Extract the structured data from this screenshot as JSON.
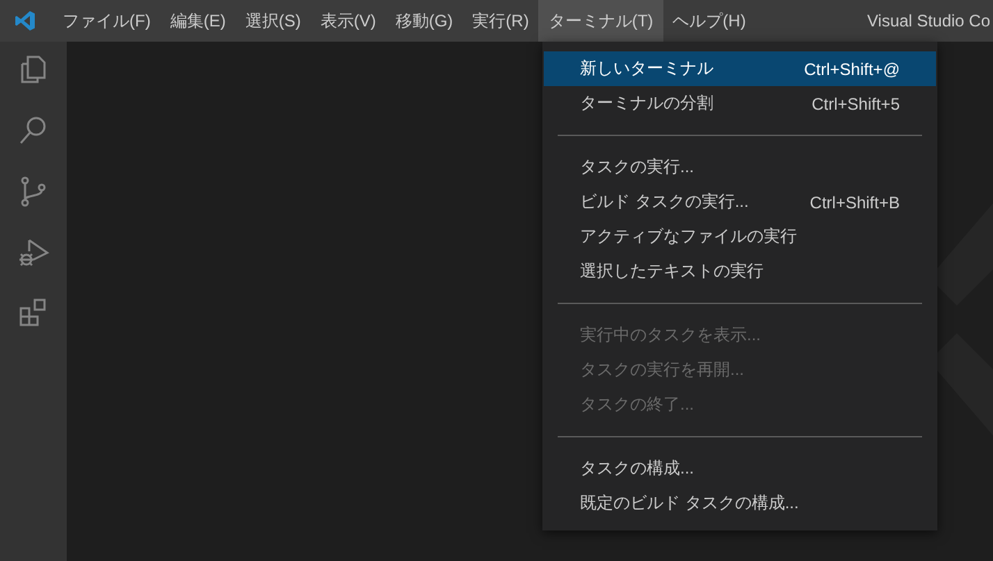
{
  "menubar": {
    "items": [
      {
        "label": "ファイル(F)",
        "selected": false
      },
      {
        "label": "編集(E)",
        "selected": false
      },
      {
        "label": "選択(S)",
        "selected": false
      },
      {
        "label": "表示(V)",
        "selected": false
      },
      {
        "label": "移動(G)",
        "selected": false
      },
      {
        "label": "実行(R)",
        "selected": false
      },
      {
        "label": "ターミナル(T)",
        "selected": true
      },
      {
        "label": "ヘルプ(H)",
        "selected": false
      }
    ],
    "title": "Visual Studio Co"
  },
  "activity_bar": {
    "items": [
      {
        "kind": "files"
      },
      {
        "kind": "search"
      },
      {
        "kind": "source-control"
      },
      {
        "kind": "run-debug"
      },
      {
        "kind": "extensions"
      }
    ]
  },
  "menu": {
    "groups": [
      [
        {
          "label": "新しいターミナル",
          "shortcut": "Ctrl+Shift+@",
          "selected": true,
          "disabled": false
        },
        {
          "label": "ターミナルの分割",
          "shortcut": "Ctrl+Shift+5",
          "selected": false,
          "disabled": false
        }
      ],
      [
        {
          "label": "タスクの実行...",
          "selected": false,
          "disabled": false
        },
        {
          "label": "ビルド タスクの実行...",
          "shortcut": "Ctrl+Shift+B",
          "selected": false,
          "disabled": false
        },
        {
          "label": "アクティブなファイルの実行",
          "selected": false,
          "disabled": false
        },
        {
          "label": "選択したテキストの実行",
          "selected": false,
          "disabled": false
        }
      ],
      [
        {
          "label": "実行中のタスクを表示...",
          "selected": false,
          "disabled": true
        },
        {
          "label": "タスクの実行を再開...",
          "selected": false,
          "disabled": true
        },
        {
          "label": "タスクの終了...",
          "selected": false,
          "disabled": true
        }
      ],
      [
        {
          "label": "タスクの構成...",
          "selected": false,
          "disabled": false
        },
        {
          "label": "既定のビルド タスクの構成...",
          "selected": false,
          "disabled": false
        }
      ]
    ]
  }
}
